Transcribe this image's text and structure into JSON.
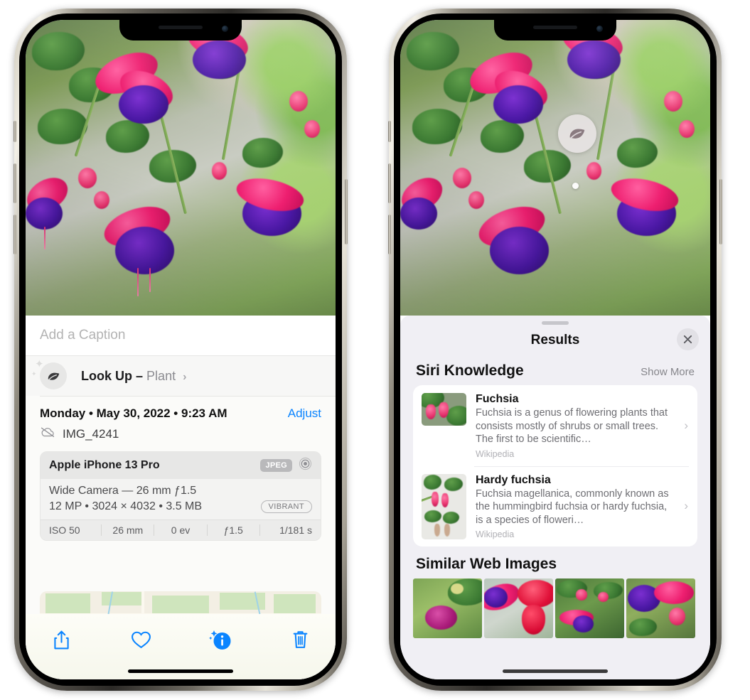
{
  "left_phone": {
    "caption": {
      "placeholder": "Add a Caption",
      "value": ""
    },
    "lookup": {
      "label": "Look Up",
      "dash": "–",
      "subject": "Plant",
      "chevron": "›",
      "icon": "leaf-icon"
    },
    "meta": {
      "date": "Monday • May 30, 2022 • 9:23 AM",
      "adjust": "Adjust",
      "filename": "IMG_4241",
      "cloud_icon": "icloud-slash-icon"
    },
    "camera": {
      "model": "Apple iPhone 13 Pro",
      "format_badge": "JPEG",
      "aperture_icon": "aperture-icon",
      "lens_line": "Wide Camera — 26 mm ƒ1.5",
      "size_line": "12 MP • 3024 × 4032 • 3.5 MB",
      "style_badge": "VIBRANT",
      "exif": [
        "ISO 50",
        "26 mm",
        "0 ev",
        "ƒ1.5",
        "1/181 s"
      ]
    },
    "toolbar": [
      {
        "name": "share-button",
        "icon": "share-icon"
      },
      {
        "name": "favorite-button",
        "icon": "heart-icon"
      },
      {
        "name": "info-button",
        "icon": "info-sparkle-icon"
      },
      {
        "name": "delete-button",
        "icon": "trash-icon"
      }
    ],
    "accent": "#0a84ff"
  },
  "right_phone": {
    "badge": {
      "icon": "leaf-icon"
    },
    "sheet": {
      "title": "Results",
      "close_icon": "close-icon"
    },
    "siri": {
      "title": "Siri Knowledge",
      "show_more": "Show More",
      "items": [
        {
          "title": "Fuchsia",
          "description": "Fuchsia is a genus of flowering plants that consists mostly of shrubs or small trees. The first to be scientific…",
          "source": "Wikipedia",
          "chevron": "›"
        },
        {
          "title": "Hardy fuchsia",
          "description": "Fuchsia magellanica, commonly known as the hummingbird fuchsia or hardy fuchsia, is a species of floweri…",
          "source": "Wikipedia",
          "chevron": "›"
        }
      ]
    },
    "similar": {
      "title": "Similar Web Images",
      "count": 4
    }
  }
}
